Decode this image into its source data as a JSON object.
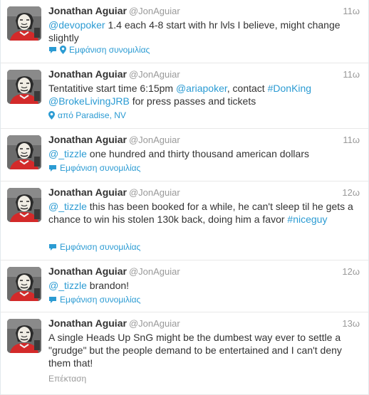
{
  "colors": {
    "link": "#2b9bd3",
    "muted": "#999999",
    "text": "#333333"
  },
  "tweets": [
    {
      "name": "Jonathan Aguiar",
      "handle": "@JonAguiar",
      "time": "11ω",
      "text": [
        {
          "t": "@devopoker",
          "link": true
        },
        {
          "t": " 1.4 each 4-8 start with hr lvls I believe, might change slightly",
          "link": false
        }
      ],
      "footer": {
        "icons": [
          "conversation-icon",
          "location-pin-icon"
        ],
        "label": "Εμφάνιση συνομιλίας",
        "style": "link"
      }
    },
    {
      "name": "Jonathan Aguiar",
      "handle": "@JonAguiar",
      "time": "11ω",
      "text": [
        {
          "t": "Tentatitive start time 6:15pm ",
          "link": false
        },
        {
          "t": "@ariapoker",
          "link": true
        },
        {
          "t": ", contact ",
          "link": false
        },
        {
          "t": "#DonKing",
          "link": true
        },
        {
          "t": " ",
          "link": false
        },
        {
          "t": "@BrokeLivingJRB",
          "link": true
        },
        {
          "t": " for press passes and tickets",
          "link": false
        }
      ],
      "footer": {
        "icons": [
          "location-pin-icon"
        ],
        "label": "από Paradise, NV",
        "style": "link"
      }
    },
    {
      "name": "Jonathan Aguiar",
      "handle": "@JonAguiar",
      "time": "11ω",
      "text": [
        {
          "t": "@_tizzle",
          "link": true
        },
        {
          "t": " one hundred and thirty thousand american dollars",
          "link": false
        }
      ],
      "footer": {
        "icons": [
          "conversation-icon"
        ],
        "label": "Εμφάνιση συνομιλίας",
        "style": "link"
      }
    },
    {
      "name": "Jonathan Aguiar",
      "handle": "@JonAguiar",
      "time": "12ω",
      "text": [
        {
          "t": "@_tizzle",
          "link": true
        },
        {
          "t": " this has been booked for a while, he can't sleep til he gets a chance to win his stolen 130k back, doing him a favor ",
          "link": false
        },
        {
          "t": "#niceguy",
          "link": true
        }
      ],
      "footer": {
        "icons": [
          "conversation-icon"
        ],
        "label": "Εμφάνιση συνομιλίας",
        "style": "link"
      }
    },
    {
      "name": "Jonathan Aguiar",
      "handle": "@JonAguiar",
      "time": "12ω",
      "text": [
        {
          "t": "@_tizzle",
          "link": true
        },
        {
          "t": " brandon!",
          "link": false
        }
      ],
      "footer": {
        "icons": [
          "conversation-icon"
        ],
        "label": "Εμφάνιση συνομιλίας",
        "style": "link"
      }
    },
    {
      "name": "Jonathan Aguiar",
      "handle": "@JonAguiar",
      "time": "13ω",
      "text": [
        {
          "t": "A single Heads Up SnG might be the dumbest way ever to settle a \"grudge\" but the people demand to be entertained and I can't deny them that!",
          "link": false
        }
      ],
      "footer": {
        "icons": [],
        "label": "Επέκταση",
        "style": "gray"
      }
    }
  ]
}
